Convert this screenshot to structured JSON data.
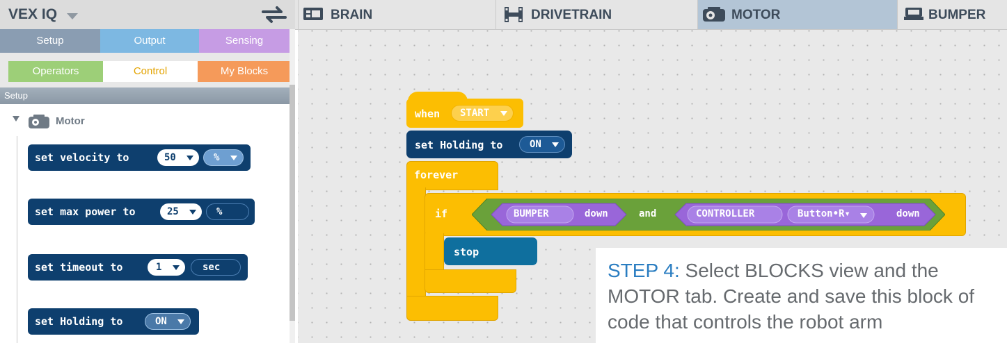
{
  "app": {
    "title": "VEX IQ"
  },
  "device_tabs": [
    {
      "label": "BRAIN",
      "icon": "brain-icon"
    },
    {
      "label": "DRIVETRAIN",
      "icon": "drivetrain-icon"
    },
    {
      "label": "MOTOR",
      "icon": "motor-icon",
      "active": true
    },
    {
      "label": "BUMPER",
      "icon": "bumper-icon"
    }
  ],
  "categories_row1": [
    {
      "label": "Setup",
      "color": "#8a9db2"
    },
    {
      "label": "Output",
      "color": "#7db8e2"
    },
    {
      "label": "Sensing",
      "color": "#c69ce4"
    }
  ],
  "categories_row2": [
    {
      "label": "Operators",
      "color": "#9dcf78"
    },
    {
      "label": "Control",
      "color": "#ffffff"
    },
    {
      "label": "My Blocks",
      "color": "#f59a5a"
    }
  ],
  "palette": {
    "section_label": "Setup",
    "group_label": "Motor",
    "blocks": [
      {
        "text": "set velocity to",
        "value": "50",
        "unit": "%"
      },
      {
        "text": "set max power to",
        "value": "25",
        "unit": "%"
      },
      {
        "text": "set timeout to",
        "value": "1",
        "unit": "sec"
      },
      {
        "text": "set Holding to",
        "value": "ON"
      }
    ]
  },
  "script": {
    "hat": {
      "keyword": "when",
      "event": "START"
    },
    "set_holding": {
      "text": "set Holding to",
      "value": "ON"
    },
    "forever": {
      "label": "forever"
    },
    "if_block": {
      "label": "if"
    },
    "condition": {
      "left": {
        "sensor": "BUMPER",
        "state": "down"
      },
      "operator": "and",
      "right": {
        "sensor": "CONTROLLER",
        "button": "Button•R▾",
        "state": "down"
      }
    },
    "stop": {
      "label": "stop"
    }
  },
  "note": {
    "step": "STEP 4:",
    "text": " Select BLOCKS view and the MOTOR tab. Create and save this block of code that controls the robot arm"
  },
  "colors": {
    "block_dark_blue": "#0e3f6e",
    "control_yellow": "#fcbe02",
    "operator_green": "#6aa13a",
    "sensing_purple": "#9966d9",
    "stop_teal": "#0f6f9e",
    "active_tab": "#b3c5d6",
    "note_step": "#2a7dc1"
  }
}
